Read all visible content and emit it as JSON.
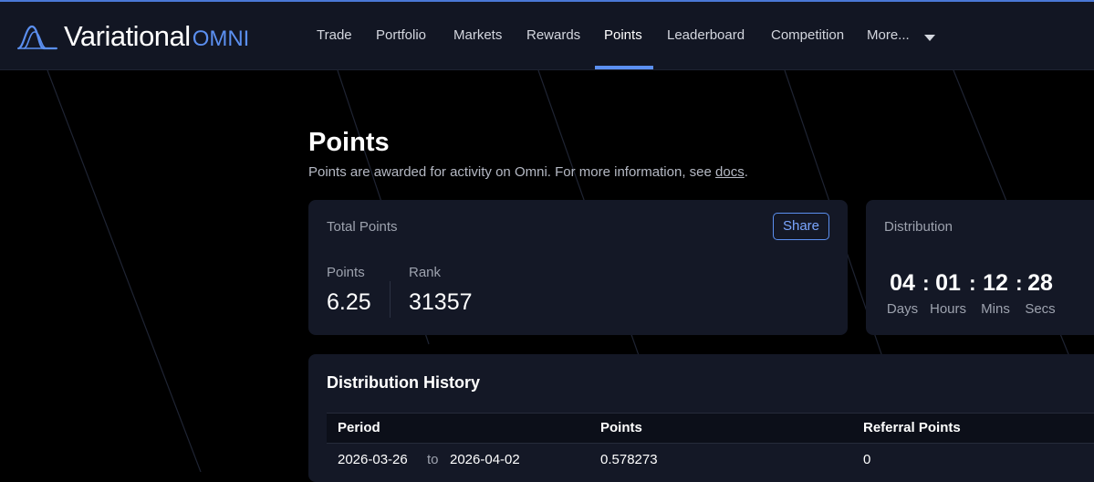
{
  "brand": {
    "name": "Variational",
    "suffix": "OMNI",
    "accent": "#5b8ff0"
  },
  "nav": {
    "items": [
      {
        "label": "Trade"
      },
      {
        "label": "Portfolio"
      },
      {
        "label": "Markets"
      },
      {
        "label": "Rewards"
      },
      {
        "label": "Points"
      },
      {
        "label": "Leaderboard"
      },
      {
        "label": "Competition"
      },
      {
        "label": "More..."
      }
    ],
    "active": "Points",
    "more_icon": "chevron-down-icon"
  },
  "page": {
    "title": "Points",
    "subtitle_prefix": "Points are awarded for activity on Omni. For more information, see",
    "subtitle_link": "docs",
    "subtitle_suffix": "."
  },
  "total_points": {
    "label": "Total Points",
    "share_label": "Share",
    "points_label": "Points",
    "points_value": "6.25",
    "rank_label": "Rank",
    "rank_value": "31357"
  },
  "distribution": {
    "label": "Distribution",
    "countdown": [
      {
        "value": "04",
        "unit": "Days"
      },
      {
        "value": "01",
        "unit": "Hours"
      },
      {
        "value": "12",
        "unit": "Mins"
      },
      {
        "value": "28",
        "unit": "Secs"
      }
    ],
    "separator": ":"
  },
  "history": {
    "title": "Distribution History",
    "columns": [
      "Period",
      "Points",
      "Referral Points"
    ],
    "rows": [
      {
        "start": "2026-03-26",
        "to": "to",
        "end": "2026-04-02",
        "points": "0.578273",
        "referral": "0"
      }
    ]
  }
}
